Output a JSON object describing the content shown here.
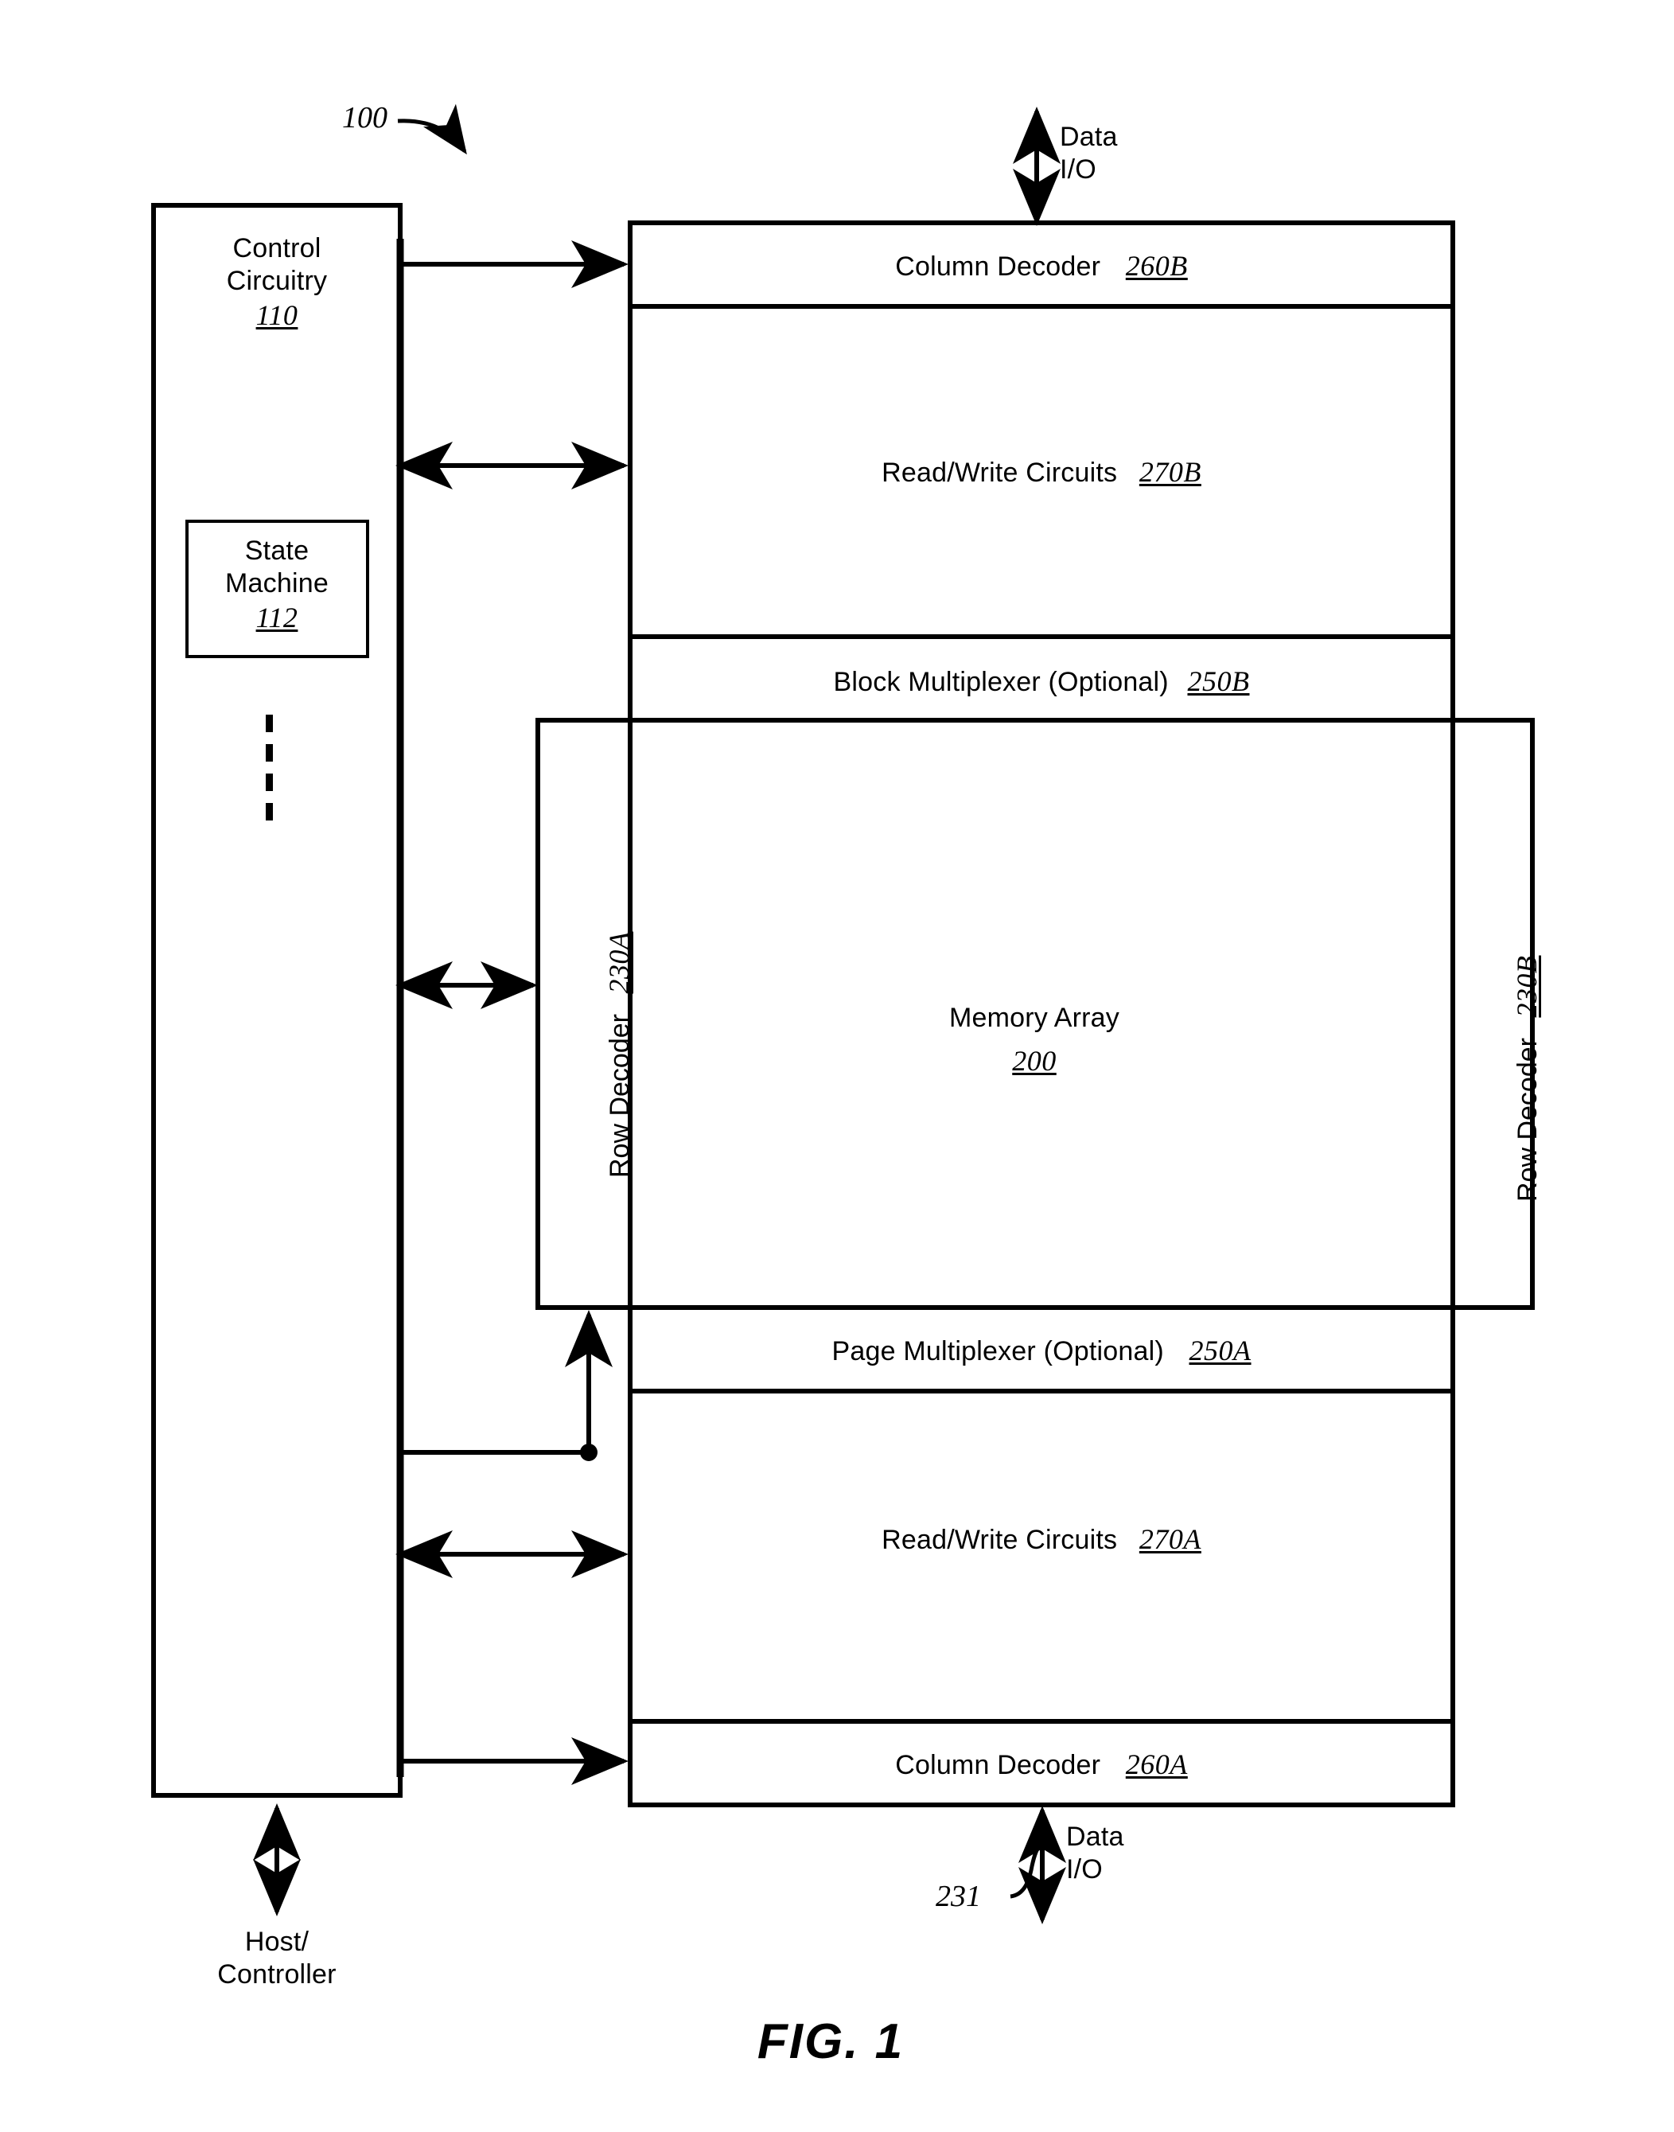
{
  "figure": {
    "caption": "FIG. 1",
    "system_tag": "100",
    "bottom_ref_tag": "231"
  },
  "blocks": {
    "control_circuitry": {
      "title_line1": "Control",
      "title_line2": "Circuitry",
      "ref": "110"
    },
    "state_machine": {
      "title_line1": "State",
      "title_line2": "Machine",
      "ref": "112"
    },
    "column_decoder_top": {
      "label": "Column Decoder",
      "ref": "260B"
    },
    "read_write_top": {
      "label": "Read/Write Circuits",
      "ref": "270B"
    },
    "block_multiplexer": {
      "label": "Block Multiplexer (Optional)",
      "ref": "250B"
    },
    "row_decoder_left": {
      "label": "Row Decoder",
      "ref": "230A"
    },
    "row_decoder_right": {
      "label": "Row Decoder",
      "ref": "230B"
    },
    "memory_array": {
      "label": "Memory Array",
      "ref": "200"
    },
    "page_multiplexer": {
      "label": "Page Multiplexer (Optional)",
      "ref": "250A"
    },
    "read_write_bottom": {
      "label": "Read/Write Circuits",
      "ref": "270A"
    },
    "column_decoder_bottom": {
      "label": "Column Decoder",
      "ref": "260A"
    }
  },
  "external_labels": {
    "data_io_top_line1": "Data",
    "data_io_top_line2": "I/O",
    "data_io_bottom_line1": "Data",
    "data_io_bottom_line2": "I/O",
    "host_controller_line1": "Host/",
    "host_controller_line2": "Controller"
  },
  "style": {
    "stroke": "#000000",
    "background": "#ffffff"
  }
}
